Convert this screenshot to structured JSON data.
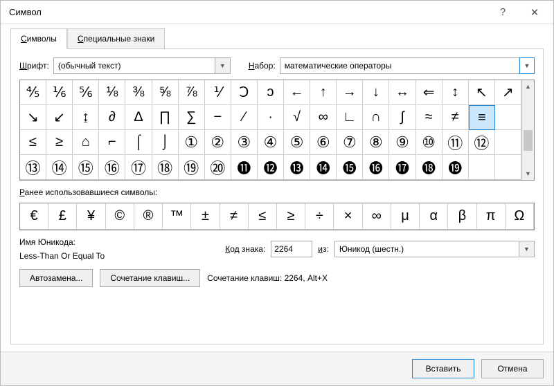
{
  "window": {
    "title": "Символ",
    "help": "?",
    "close": "✕"
  },
  "tabs": {
    "symbols": "Символы",
    "symbols_ul": "С",
    "special": "Специальные знаки",
    "special_ul": "С"
  },
  "font": {
    "label": "Шрифт:",
    "label_ul": "Ш",
    "value": "(обычный текст)"
  },
  "subset": {
    "label": "Набор:",
    "label_ul": "Н",
    "value": "математические операторы"
  },
  "grid": [
    "⅘",
    "⅙",
    "⅚",
    "⅛",
    "⅜",
    "⅝",
    "⅞",
    "⅟",
    "Ↄ",
    "ↄ",
    "←",
    "↑",
    "→",
    "↓",
    "↔",
    "⇐",
    "↕",
    "↖",
    "↗",
    "↘",
    "↙",
    "↨",
    "∂",
    "∆",
    "∏",
    "∑",
    "−",
    "∕",
    "∙",
    "√",
    "∞",
    "∟",
    "∩",
    "∫",
    "≈",
    "≠",
    "≡",
    "≤",
    "≥",
    "⌂",
    "⌐",
    "⌠",
    "⌡",
    "①",
    "②",
    "③",
    "④",
    "⑤",
    "⑥",
    "⑦",
    "⑧",
    "⑨",
    "⑩",
    "⑪",
    "⑫",
    "⑬",
    "⑭",
    "⑮",
    "⑯",
    "⑰",
    "⑱",
    "⑲",
    "⑳",
    "⓫",
    "⓬",
    "⓭",
    "⓮",
    "⓯",
    "⓰",
    "⓱",
    "⓲",
    "⓳"
  ],
  "grid_row1_last": "↗",
  "grid_selected_index": 37,
  "recent_label": "Ранее использовавшиеся символы:",
  "recent_ul": "Р",
  "recent": [
    "€",
    "£",
    "¥",
    "©",
    "®",
    "™",
    "±",
    "≠",
    "≤",
    "≥",
    "÷",
    "×",
    "∞",
    "μ",
    "α",
    "β",
    "π",
    "Ω"
  ],
  "unicode_name_label": "Имя Юникода:",
  "unicode_name": "Less-Than Or Equal To",
  "code_label": "Код знака:",
  "code_ul": "К",
  "code_value": "2264",
  "from_label": "из:",
  "from_ul": "и",
  "from_value": "Юникод (шестн.)",
  "autocorrect_btn": "Автозамена...",
  "shortcut_btn": "Сочетание клавиш...",
  "shortcut_label": "Сочетание клавиш: 2264, Alt+X",
  "insert_btn": "Вставить",
  "cancel_btn": "Отмена"
}
